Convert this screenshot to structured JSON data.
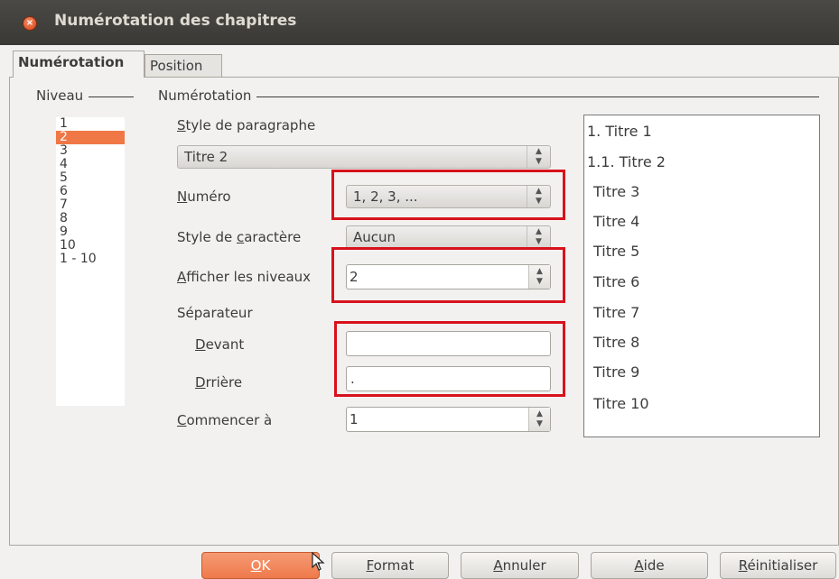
{
  "window": {
    "title": "Numérotation des chapitres"
  },
  "tabs": [
    {
      "label": "Numérotation",
      "active": true
    },
    {
      "label": "Position",
      "active": false
    }
  ],
  "level": {
    "frame_label": "Niveau",
    "items": [
      "1",
      "2",
      "3",
      "4",
      "5",
      "6",
      "7",
      "8",
      "9",
      "10",
      "1 - 10"
    ],
    "selected": "2"
  },
  "numbering": {
    "frame_label": "Numérotation",
    "paragraph_style_label_u": "S",
    "paragraph_style_label_rest": "tyle de paragraphe",
    "paragraph_style_value": "Titre 2",
    "number_label_u": "N",
    "number_label_rest": "uméro",
    "number_value": "1, 2, 3, ...",
    "char_style_label_pre": "Style de ",
    "char_style_label_u": "c",
    "char_style_label_rest": "aractère",
    "char_style_value": "Aucun",
    "show_levels_label_u": "A",
    "show_levels_label_rest": "fficher les niveaux",
    "show_levels_value": "2",
    "separator_label": "Séparateur",
    "before_label_u": "D",
    "before_label_rest": "evant",
    "before_value": "",
    "after_label_pre": "D",
    "after_label_u": "e",
    "after_label_rest": "rrière",
    "after_value": ".",
    "start_label_u": "C",
    "start_label_rest": "ommencer à",
    "start_value": "1"
  },
  "preview": [
    "1. Titre 1",
    "1.1. Titre 2",
    "Titre 3",
    "Titre 4",
    "Titre 5",
    "Titre 6",
    "Titre 7",
    "Titre 8",
    "Titre 9",
    "Titre 10"
  ],
  "buttons": {
    "ok_u": "O",
    "ok_rest": "K",
    "format_u": "F",
    "format_rest": "ormat",
    "cancel_u": "A",
    "cancel_rest": "nnuler",
    "help_u": "A",
    "help_rest": "ide",
    "reset_u": "R",
    "reset_rest": "éinitialiser"
  },
  "colors": {
    "accent": "#f07746",
    "highlight_box": "#d8111c",
    "titlebar": "#3e3d39"
  },
  "icons": {
    "close": "close-icon",
    "spin": "spin-arrows-icon",
    "combo": "combo-arrows-icon",
    "cursor": "mouse-pointer-icon"
  }
}
